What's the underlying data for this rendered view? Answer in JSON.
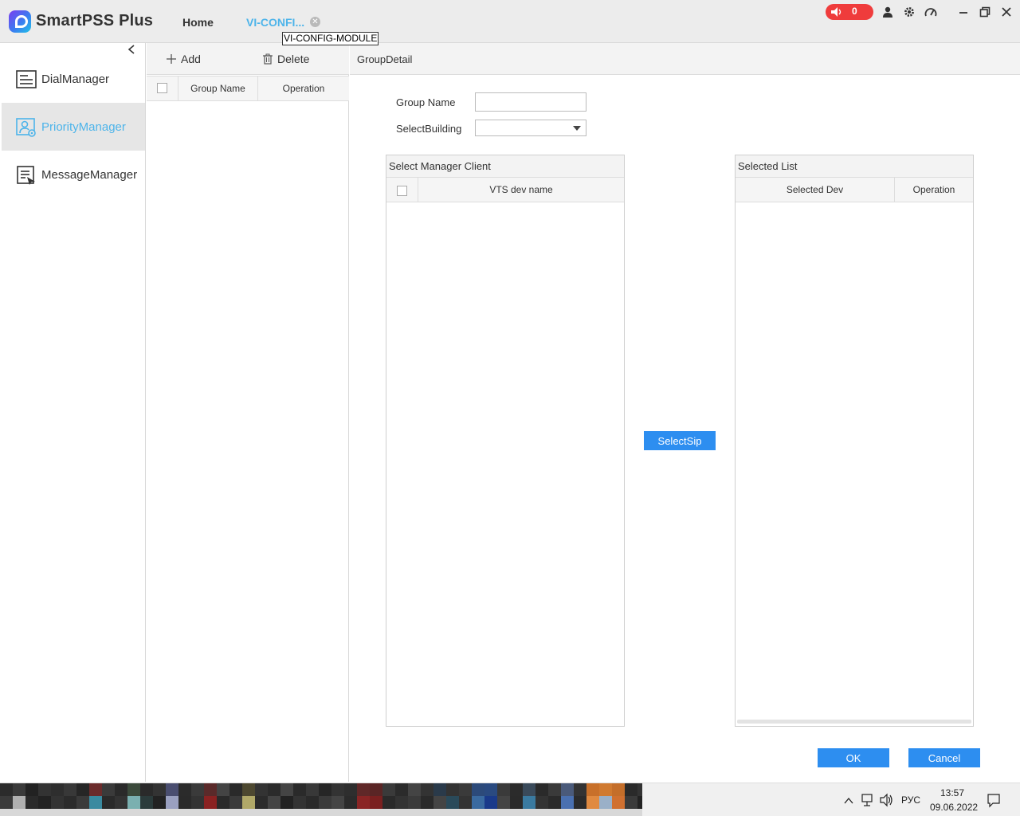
{
  "app": {
    "title": "SmartPSS Plus",
    "tabs": [
      {
        "label": "Home"
      },
      {
        "label": "VI-CONFI...",
        "tooltip": "VI-CONFIG-MODULE"
      }
    ],
    "alarm_count": "0",
    "accent_color": "#4db4ea",
    "alarm_color": "#ef3c3c",
    "button_color": "#2d8ef0"
  },
  "nav": {
    "items": [
      {
        "label": "DialManager",
        "icon": "dial-list-icon",
        "active": false
      },
      {
        "label": "PriorityManager",
        "icon": "priority-user-icon",
        "active": true
      },
      {
        "label": "MessageManager",
        "icon": "message-edit-icon",
        "active": false
      }
    ]
  },
  "groups": {
    "add_label": "Add",
    "delete_label": "Delete",
    "columns": [
      "Group Name",
      "Operation"
    ],
    "rows": []
  },
  "detail": {
    "title": "GroupDetail",
    "group_name_label": "Group Name",
    "group_name_value": "",
    "building_label": "SelectBuilding",
    "building_value": "",
    "manager_client": {
      "title": "Select Manager Client",
      "columns": [
        "VTS dev name"
      ],
      "rows": []
    },
    "select_sip_label": "SelectSip",
    "selected_list": {
      "title": "Selected List",
      "columns": [
        "Selected Dev",
        "Operation"
      ],
      "rows": []
    },
    "ok_label": "OK",
    "cancel_label": "Cancel"
  },
  "taskbar": {
    "language": "РУС",
    "time": "13:57",
    "date": "09.06.2022"
  }
}
